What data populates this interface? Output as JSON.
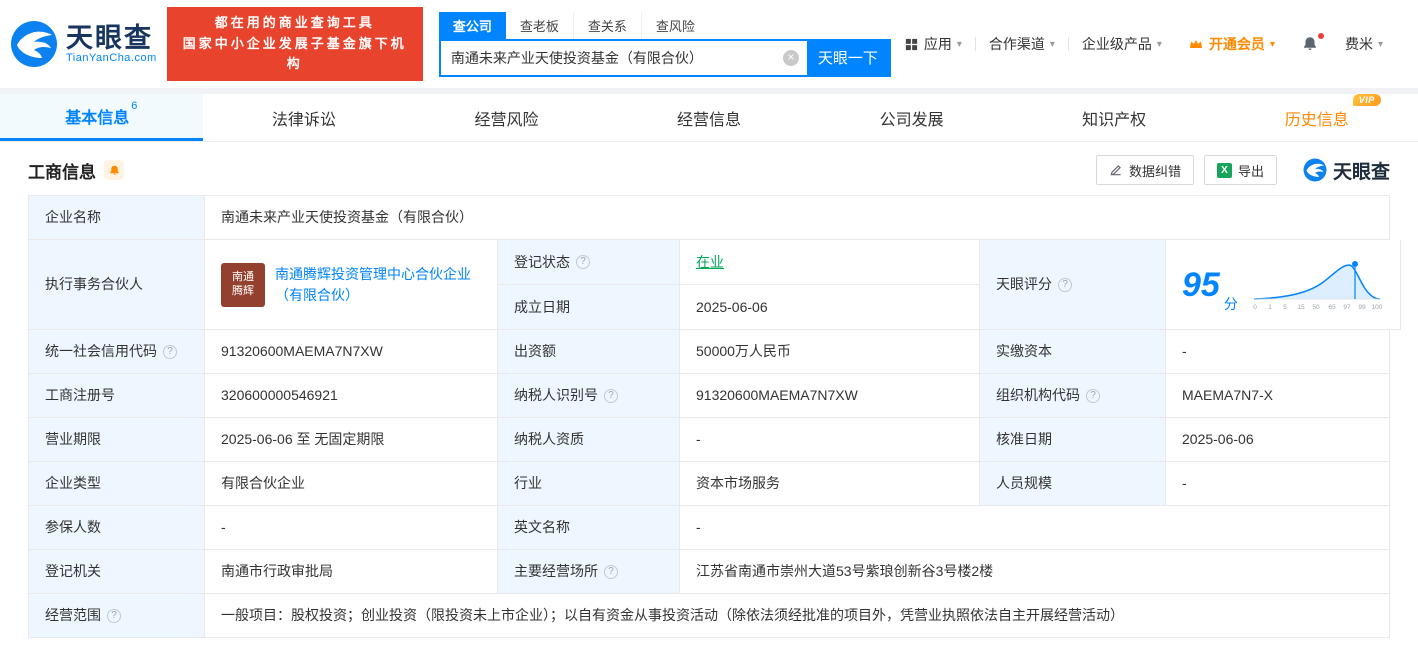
{
  "brand": {
    "name": "天眼查",
    "domain": "TianYanCha.com",
    "banner_line1": "都在用的商业查询工具",
    "banner_line2": "国家中小企业发展子基金旗下机构"
  },
  "icons": {
    "help": "?",
    "caret": "▾",
    "clear": "×",
    "excel": "X"
  },
  "search": {
    "tabs": [
      "查公司",
      "查老板",
      "查关系",
      "查风险"
    ],
    "value": "南通未来产业天使投资基金（有限合伙）",
    "button": "天眼一下"
  },
  "topmenu": {
    "apps": "应用",
    "channel": "合作渠道",
    "enterprise": "企业级产品",
    "vip": "开通会员",
    "user": "费米"
  },
  "tabs": {
    "basic": "基本信息",
    "basic_count": "6",
    "lawsuit": "法律诉讼",
    "risk": "经营风险",
    "operating": "经营信息",
    "development": "公司发展",
    "ip": "知识产权",
    "history": "历史信息",
    "vip_badge": "VIP"
  },
  "section": {
    "title": "工商信息",
    "correction": "数据纠错",
    "export": "导出",
    "watermark": "天眼查"
  },
  "info": {
    "company_name_label": "企业名称",
    "company_name": "南通未来产业天使投资基金（有限合伙）",
    "partner_label": "执行事务合伙人",
    "partner_badge_top": "南通",
    "partner_badge_bottom": "腾辉",
    "partner_name": "南通腾辉投资管理中心合伙企业（有限合伙）",
    "reg_status_label": "登记状态",
    "reg_status": "在业",
    "establish_date_label": "成立日期",
    "establish_date": "2025-06-06",
    "score_label": "天眼评分",
    "score_value": "95",
    "score_unit": "分",
    "score_ticks": [
      "0",
      "1",
      "5",
      "15",
      "50",
      "65",
      "97",
      "99",
      "100"
    ],
    "credit_code_label": "统一社会信用代码",
    "credit_code": "91320600MAEMA7N7XW",
    "capital_label": "出资额",
    "capital": "50000万人民币",
    "paid_capital_label": "实缴资本",
    "paid_capital": "-",
    "reg_number_label": "工商注册号",
    "reg_number": "320600000546921",
    "taxpayer_id_label": "纳税人识别号",
    "taxpayer_id": "91320600MAEMA7N7XW",
    "org_code_label": "组织机构代码",
    "org_code": "MAEMA7N7-X",
    "term_label": "营业期限",
    "term": "2025-06-06 至 无固定期限",
    "taxpayer_quality_label": "纳税人资质",
    "taxpayer_quality": "-",
    "approval_date_label": "核准日期",
    "approval_date": "2025-06-06",
    "company_type_label": "企业类型",
    "company_type": "有限合伙企业",
    "industry_label": "行业",
    "industry": "资本市场服务",
    "staff_size_label": "人员规模",
    "staff_size": "-",
    "insured_label": "参保人数",
    "insured": "-",
    "english_name_label": "英文名称",
    "english_name": "-",
    "reg_authority_label": "登记机关",
    "reg_authority": "南通市行政审批局",
    "address_label": "主要经营场所",
    "address": "江苏省南通市崇州大道53号紫琅创新谷3号楼2楼",
    "scope_label": "经营范围",
    "scope": "一般项目：股权投资；创业投资（限投资未上市企业）；以自有资金从事投资活动（除依法须经批准的项目外，凭营业执照依法自主开展经营活动）"
  },
  "colors": {
    "primary": "#0084ff",
    "banner_red": "#e8432c",
    "status_green": "#00a65a",
    "vip_orange": "#ff8a00"
  }
}
